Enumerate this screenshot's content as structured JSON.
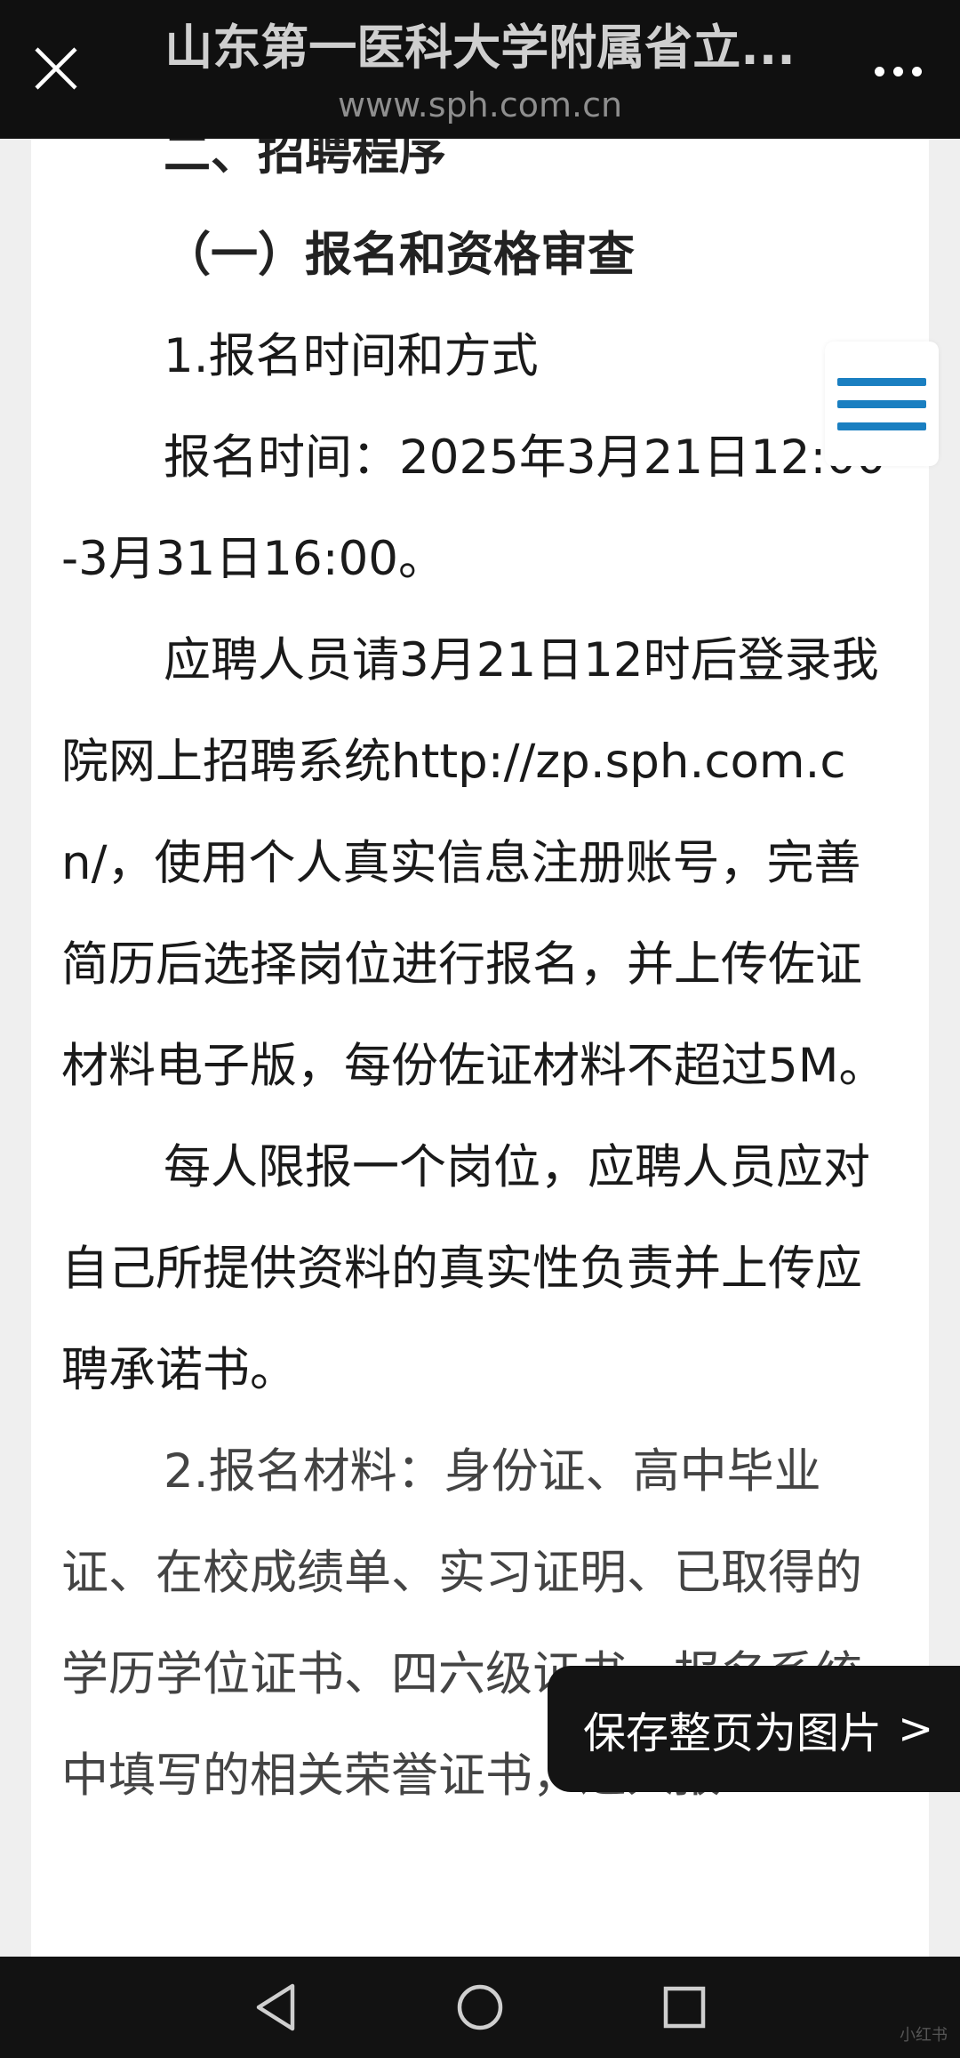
{
  "header": {
    "title": "山东第一医科大学附属省立...",
    "url": "www.sph.com.cn"
  },
  "icons": {
    "close": "close-icon",
    "more": "more-icon",
    "menu": "hamburger-menu-icon",
    "back": "back-icon",
    "home": "home-icon",
    "recent": "recent-apps-icon"
  },
  "article": {
    "section_title": "二、招聘程序",
    "subsection_title": "（一）报名和资格审查",
    "item1_title": "1.报名时间和方式",
    "registration_time": "报名时间：2025年3月21日12:00-3月31日16:00。",
    "instructions": "应聘人员请3月21日12时后登录我院网上招聘系统http://zp.sph.com.cn/，使用个人真实信息注册账号，完善简历后选择岗位进行报名，并上传佐证材料电子版，每份佐证材料不超过5M。",
    "limit": "每人限报一个岗位，应聘人员应对自己所提供资料的真实性负责并上传应聘承诺书。",
    "materials": "2.报名材料：身份证、高中毕业证、在校成绩单、实习证明、已取得的学历学位证书、四六级证书、报名系统中填写的相关荣誉证书，进入报"
  },
  "save_action": {
    "label": "保存整页为图片",
    "chevron": ">"
  },
  "watermark": "小红书",
  "colors": {
    "accent_menu": "#1a7fc1",
    "topbar_bg": "#101010",
    "nav_bg": "#121212"
  }
}
